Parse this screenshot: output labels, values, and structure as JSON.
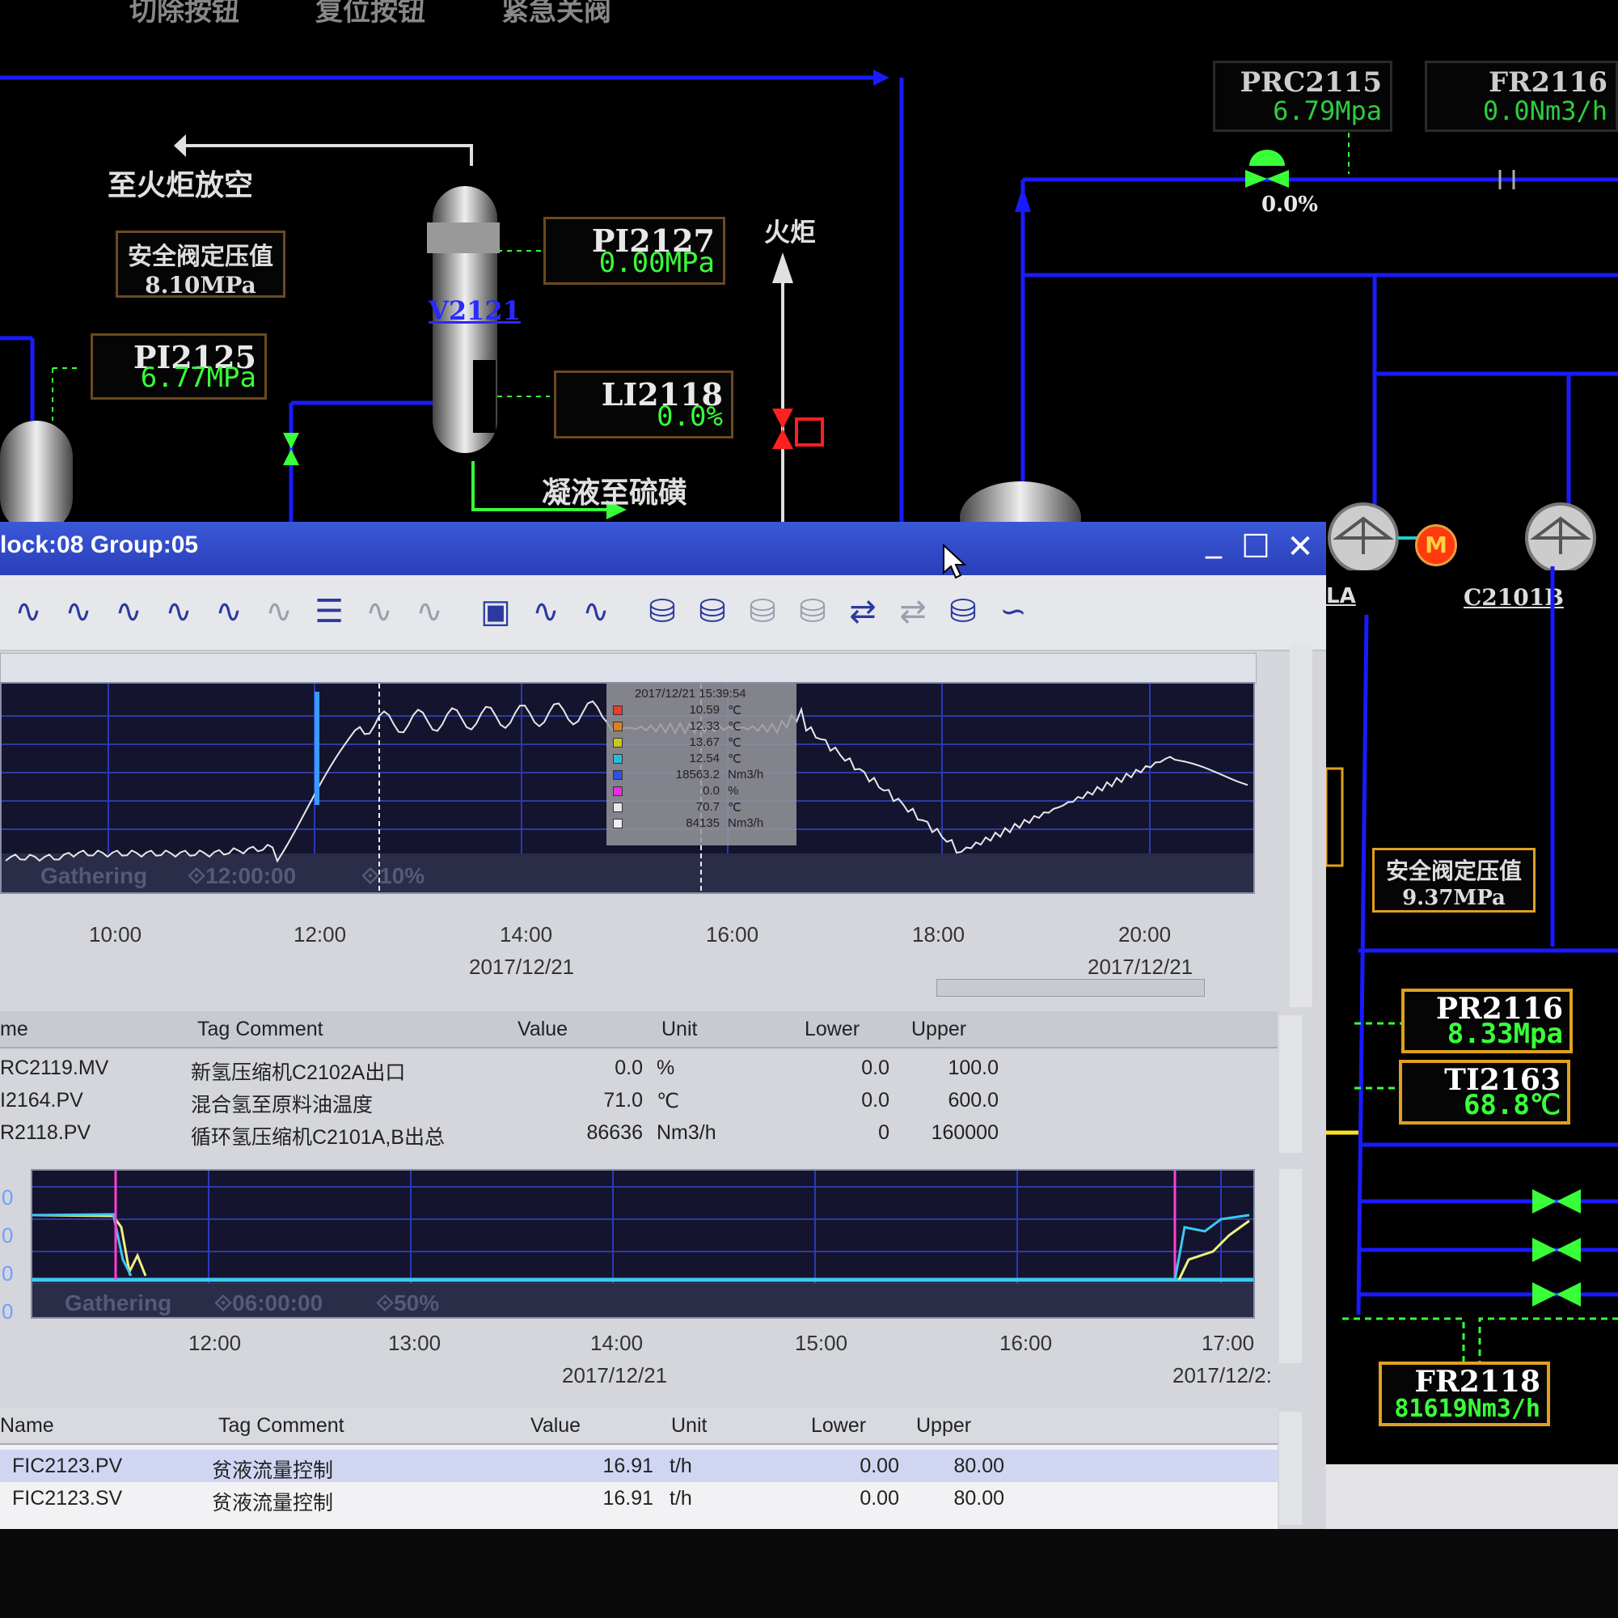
{
  "top_buttons": [
    "切除按钮",
    "复位按钮",
    "紧急关阀"
  ],
  "process": {
    "flare_vent": "至火炬放空",
    "safety_valve_left": {
      "label": "安全阀定压值",
      "value": "8.10MPa"
    },
    "pi2125": {
      "tag": "PI2125",
      "value": "6.77MPa"
    },
    "pi2127": {
      "tag": "PI2127",
      "value": "0.00MPa"
    },
    "li2118": {
      "tag": "LI2118",
      "value": "0.0%"
    },
    "vessel": "V2121",
    "flare": "火炬",
    "condensate": "凝液至硫磺",
    "prc2115": {
      "tag": "PRC2115",
      "value": "6.79Mpa"
    },
    "fr2116": {
      "tag": "FR2116",
      "value": "0.0Nm3/h"
    },
    "valve_pct": "0.0%",
    "comp_left": "LA",
    "comp_right": "C2101B",
    "motor": "M",
    "safety_valve_right": {
      "label": "安全阀定压值",
      "value": "9.37MPa"
    },
    "pr2116": {
      "tag": "PR2116",
      "value": "8.33Mpa"
    },
    "ti2163": {
      "tag": "TI2163",
      "value": "68.8℃"
    },
    "fr2118": {
      "tag": "FR2118",
      "value": "81619Nm3/h"
    }
  },
  "window": {
    "title": "lock:08 Group:05",
    "min": "_",
    "max": "☐",
    "close": "✕",
    "icons": [
      "trend-icon",
      "trend-icon",
      "trend-icon",
      "trend-icon",
      "trend-icon",
      "trend-icon",
      "list-icon",
      "trend-icon",
      "trend-icon",
      "chart-icon",
      "trend-icon",
      "trend-icon",
      "database-icon",
      "database-icon",
      "database-icon",
      "database-icon",
      "arrows-icon",
      "arrows-icon",
      "database-icon",
      "wave-icon"
    ]
  },
  "chart1": {
    "gathering": "Gathering",
    "span": "⟐12:00:00",
    "pct": "⟐10%",
    "xticks": [
      "10:00",
      "12:00",
      "14:00",
      "16:00",
      "18:00",
      "20:00"
    ],
    "dates": [
      "2017/12/21",
      "2017/12/21"
    ],
    "tooltip": {
      "time": "2017/12/21 15:39:54",
      "rows": [
        {
          "value": "10.59",
          "unit": "℃",
          "color": "#e04030"
        },
        {
          "value": "12.33",
          "unit": "℃",
          "color": "#e08020"
        },
        {
          "value": "13.67",
          "unit": "℃",
          "color": "#c8c820"
        },
        {
          "value": "12.54",
          "unit": "℃",
          "color": "#30b8d8"
        },
        {
          "value": "18563.2",
          "unit": "Nm3/h",
          "color": "#3050e0"
        },
        {
          "value": "0.0",
          "unit": "%",
          "color": "#e030e0"
        },
        {
          "value": "70.7",
          "unit": "℃",
          "color": "#e8e8e8"
        },
        {
          "value": "84135",
          "unit": "Nm3/h",
          "color": "#f0f0f0"
        }
      ]
    }
  },
  "table1": {
    "headers": [
      "me",
      "Tag Comment",
      "Value",
      "Unit",
      "Lower",
      "Upper"
    ],
    "rows": [
      [
        "RC2119.MV",
        "新氢压缩机C2102A出口",
        "0.0",
        "%",
        "0.0",
        "100.0"
      ],
      [
        "I2164.PV",
        "混合氢至原料油温度",
        "71.0",
        "℃",
        "0.0",
        "600.0"
      ],
      [
        "R2118.PV",
        "循环氢压缩机C2101A,B出总",
        "86636",
        "Nm3/h",
        "0",
        "160000"
      ]
    ]
  },
  "chart2": {
    "gathering": "Gathering",
    "span": "⟐06:00:00",
    "pct": "⟐50%",
    "xticks": [
      "12:00",
      "13:00",
      "14:00",
      "15:00",
      "16:00",
      "17:00"
    ],
    "dates": [
      "2017/12/21",
      "2017/12/2:"
    ],
    "ylabels": [
      "0",
      "0",
      "0",
      "0"
    ]
  },
  "table2": {
    "headers": [
      "Name",
      "Tag Comment",
      "Value",
      "Unit",
      "Lower",
      "Upper"
    ],
    "rows": [
      [
        "FIC2123.PV",
        "贫液流量控制",
        "16.91",
        "t/h",
        "0.00",
        "80.00"
      ],
      [
        "FIC2123.SV",
        "贫液流量控制",
        "16.91",
        "t/h",
        "0.00",
        "80.00"
      ]
    ]
  },
  "colors": {
    "pipe": "#1a1aff",
    "value_green": "#39ff39",
    "title_blue": "#2a3fb8"
  }
}
